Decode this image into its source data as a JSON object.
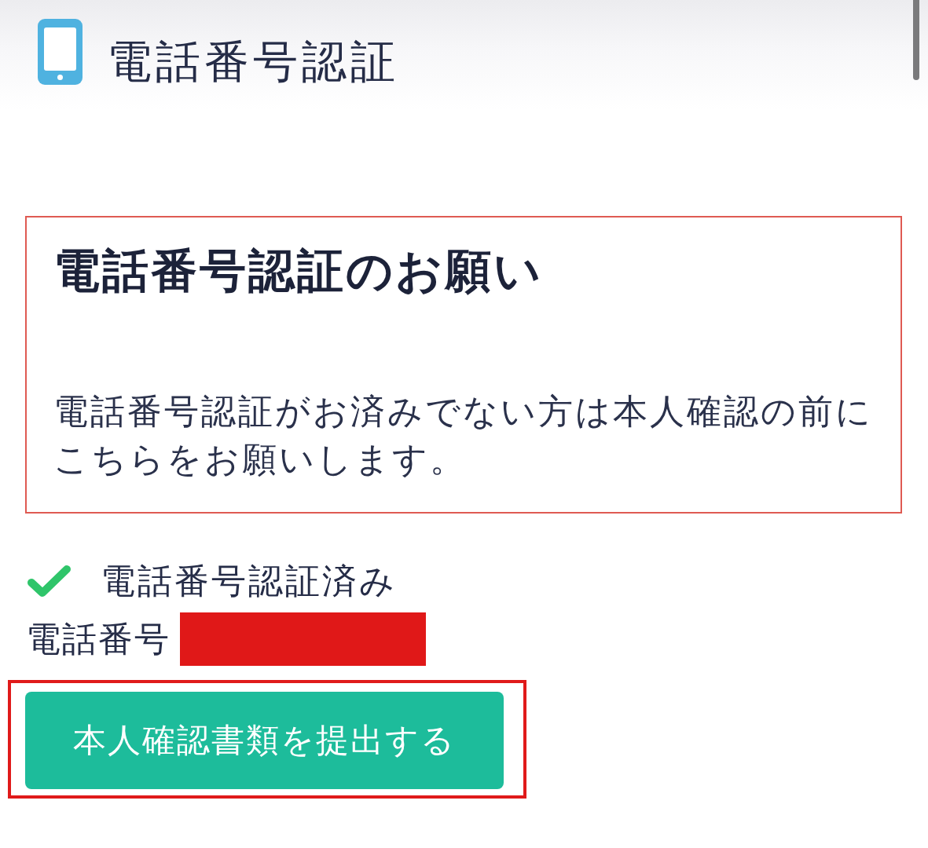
{
  "header": {
    "title": "電話番号認証"
  },
  "notice": {
    "title": "電話番号認証のお願い",
    "body": "電話番号認証がお済みでない方は本人確認の前にこちらをお願いします。"
  },
  "verification": {
    "verified": true,
    "label": "電話番号認証済み"
  },
  "phone": {
    "label": "電話番号",
    "redacted": true
  },
  "submit_button": {
    "label": "本人確認書類を提出する",
    "highlighted": true
  }
}
